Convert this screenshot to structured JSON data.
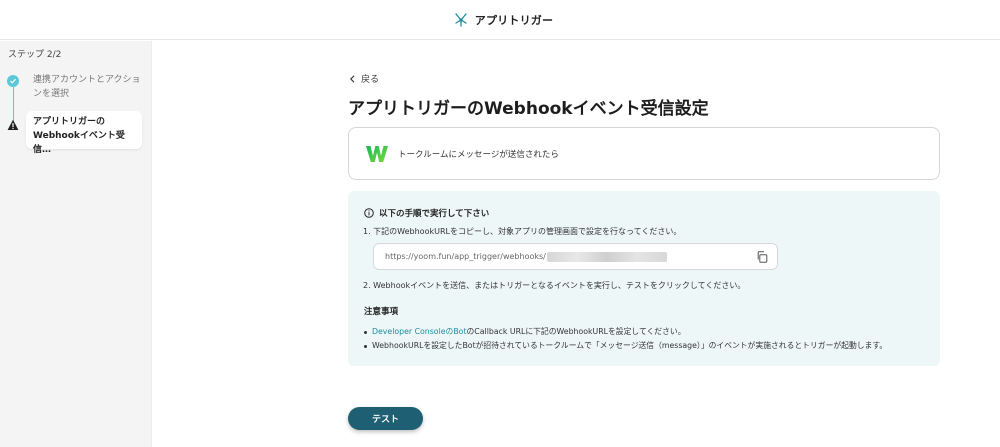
{
  "header": {
    "title": "アプリトリガー"
  },
  "sidebar": {
    "step_count": "ステップ 2/2",
    "steps": [
      {
        "label": "連携アカウントとアクションを選択",
        "status": "done"
      },
      {
        "label": "アプリトリガーのWebhookイベント受信…",
        "status": "warning"
      }
    ]
  },
  "main": {
    "back_label": "戻る",
    "title": "アプリトリガーのWebhookイベント受信設定",
    "event": {
      "label": "トークルームにメッセージが送信されたら",
      "icon": "line-works-logo"
    },
    "instructions": {
      "header": "以下の手順で実行して下さい",
      "step1": "1. 下記のWebhookURLをコピーし、対象アプリの管理画面で設定を行なってください。",
      "url": "https://yoom.fun/app_trigger/webhooks/",
      "step2": "2. Webhookイベントを送信、またはトリガーとなるイベントを実行し、テストをクリックしてください。",
      "notes_title": "注意事項",
      "note1_link": "Developer ConsoleのBot",
      "note1_text": "のCallback URLに下記のWebhookURLを設定してください。",
      "note2": "WebhookURLを設定したBotが招待されているトークルームで「メッセージ送信（message）」のイベントが実施されるとトリガーが起動します。"
    },
    "test_button": "テスト"
  },
  "colors": {
    "accent": "#1e5f73",
    "teal": "#5cc7d6",
    "link": "#1e8aa0",
    "panel_bg": "#eef7f7"
  }
}
